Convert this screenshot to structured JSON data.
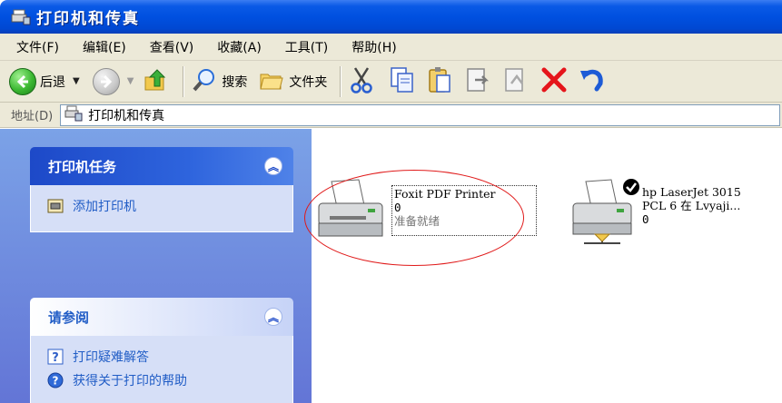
{
  "window": {
    "title": "打印机和传真"
  },
  "menu": [
    "文件(F)",
    "编辑(E)",
    "查看(V)",
    "收藏(A)",
    "工具(T)",
    "帮助(H)"
  ],
  "toolbar": {
    "back_label": "后退",
    "search_label": "搜索",
    "folders_label": "文件夹"
  },
  "address": {
    "label": "地址(D)",
    "value": "打印机和传真"
  },
  "tasks_panel": {
    "title": "打印机任务",
    "items": [
      {
        "label": "添加打印机",
        "icon": "add-printer-icon"
      }
    ]
  },
  "see_also_panel": {
    "title": "请参阅",
    "items": [
      {
        "label": "打印疑难解答",
        "icon": "help-question-icon"
      },
      {
        "label": "获得关于打印的帮助",
        "icon": "help-circle-icon"
      }
    ]
  },
  "printers": [
    {
      "name": "Foxit PDF Printer",
      "docs": "0",
      "status": "准备就绪",
      "selected": true
    },
    {
      "name_line1": "hp LaserJet 3015",
      "name_line2": "PCL 6 在 Lvyaji...",
      "docs": "0",
      "default": true
    }
  ],
  "colors": {
    "title_bar": "#0050e0",
    "task_pane": "#6f8fe0",
    "annotation": "#e01a1a"
  }
}
